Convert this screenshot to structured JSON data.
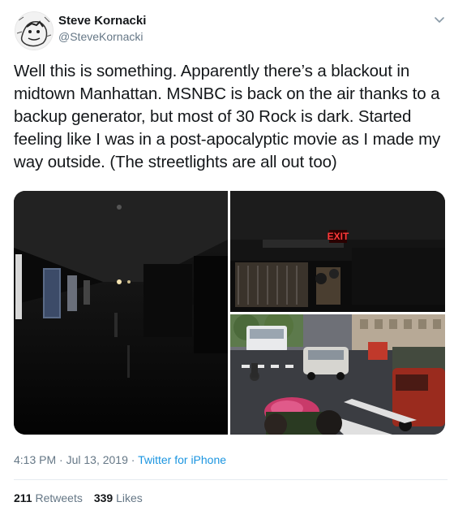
{
  "user": {
    "name": "Steve Kornacki",
    "handle": "@SteveKornacki"
  },
  "tweet": {
    "text": "Well this is something. Apparently there’s a blackout in midtown Manhattan. MSNBC is back on the air thanks to a backup generator, but most of 30 Rock is dark. Started feeling like I was in a post-apocalyptic movie as I made my way outside. (The streetlights are all out too)"
  },
  "photos": {
    "exit_sign": "EXIT"
  },
  "meta": {
    "time": "4:13 PM",
    "date": "Jul 13, 2019",
    "separator": "·",
    "source": "Twitter for iPhone"
  },
  "stats": {
    "retweets_count": "211",
    "retweets_label": "Retweets",
    "likes_count": "339",
    "likes_label": "Likes"
  },
  "icons": {
    "avatar": "avatar-sketch",
    "menu": "chevron-down-icon"
  }
}
